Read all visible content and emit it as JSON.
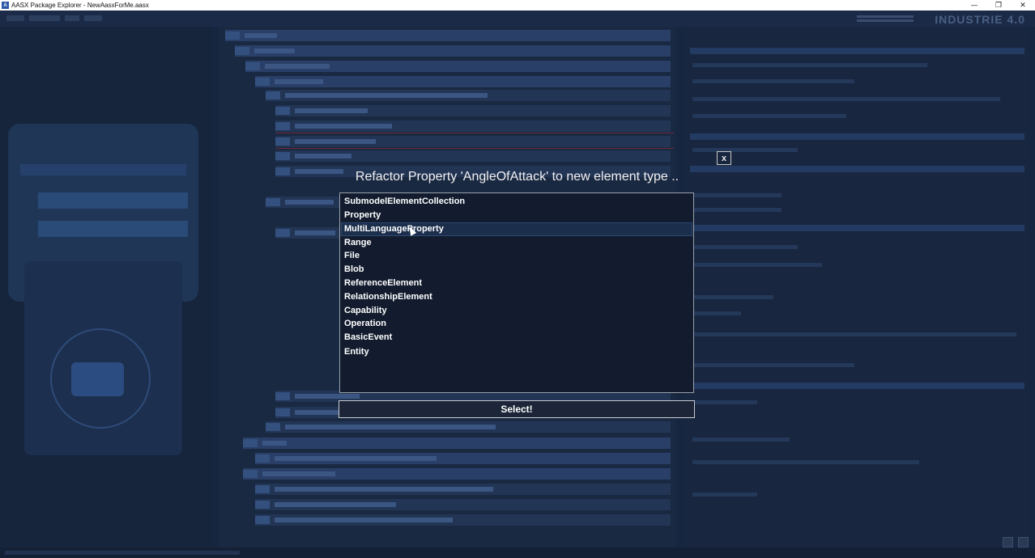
{
  "window": {
    "title": "AASX Package Explorer - NewAasxForMe.aasx",
    "app_icon": "aasx-icon",
    "buttons": {
      "minimize": "—",
      "restore": "❐",
      "close": "✕"
    }
  },
  "background": {
    "logo": "INDUSTRIE 4.0"
  },
  "dialog": {
    "title": "Refactor Property 'AngleOfAttack' to new element type ..",
    "close_label": "x",
    "items": [
      {
        "label": "SubmodelElementCollection"
      },
      {
        "label": "Property"
      },
      {
        "label": "MultiLanguageProperty",
        "hovered": true
      },
      {
        "label": "Range"
      },
      {
        "label": "File"
      },
      {
        "label": "Blob"
      },
      {
        "label": "ReferenceElement"
      },
      {
        "label": "RelationshipElement"
      },
      {
        "label": "Capability"
      },
      {
        "label": "Operation"
      },
      {
        "label": "BasicEvent"
      },
      {
        "label": "Entity"
      }
    ],
    "select_label": "Select!"
  }
}
